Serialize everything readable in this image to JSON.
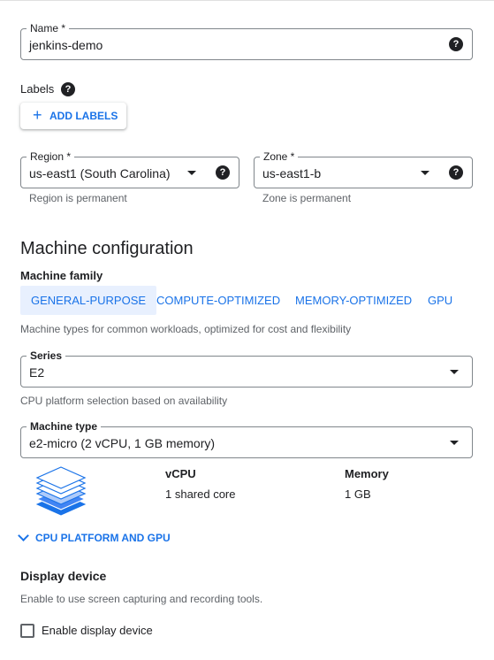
{
  "name_field": {
    "label": "Name *",
    "value": "jenkins-demo",
    "help": "?"
  },
  "labels": {
    "title": "Labels",
    "help": "?",
    "add_button": "ADD LABELS",
    "add_icon": "+"
  },
  "region": {
    "label": "Region *",
    "value": "us-east1 (South Carolina)",
    "hint": "Region is permanent",
    "help": "?"
  },
  "zone": {
    "label": "Zone *",
    "value": "us-east1-b",
    "hint": "Zone is permanent",
    "help": "?"
  },
  "machine_config": {
    "title": "Machine configuration",
    "family_label": "Machine family",
    "tabs": [
      "GENERAL-PURPOSE",
      "COMPUTE-OPTIMIZED",
      "MEMORY-OPTIMIZED",
      "GPU"
    ],
    "active_tab": "GENERAL-PURPOSE",
    "family_description": "Machine types for common workloads, optimized for cost and flexibility",
    "series": {
      "label": "Series",
      "value": "E2",
      "hint": "CPU platform selection based on availability"
    },
    "machine_type": {
      "label": "Machine type",
      "value": "e2-micro (2 vCPU, 1 GB memory)"
    },
    "specs": {
      "vcpu_header": "vCPU",
      "vcpu_value": "1 shared core",
      "memory_header": "Memory",
      "memory_value": "1 GB"
    },
    "expander": "CPU PLATFORM AND GPU"
  },
  "display_device": {
    "title": "Display device",
    "description": "Enable to use screen capturing and recording tools.",
    "checkbox_label": "Enable display device",
    "checked": false
  },
  "colors": {
    "accent": "#1a73e8",
    "active_tab_bg": "#e8f0fe",
    "border": "#80868b",
    "hint": "#5f6368",
    "text": "#202124"
  }
}
